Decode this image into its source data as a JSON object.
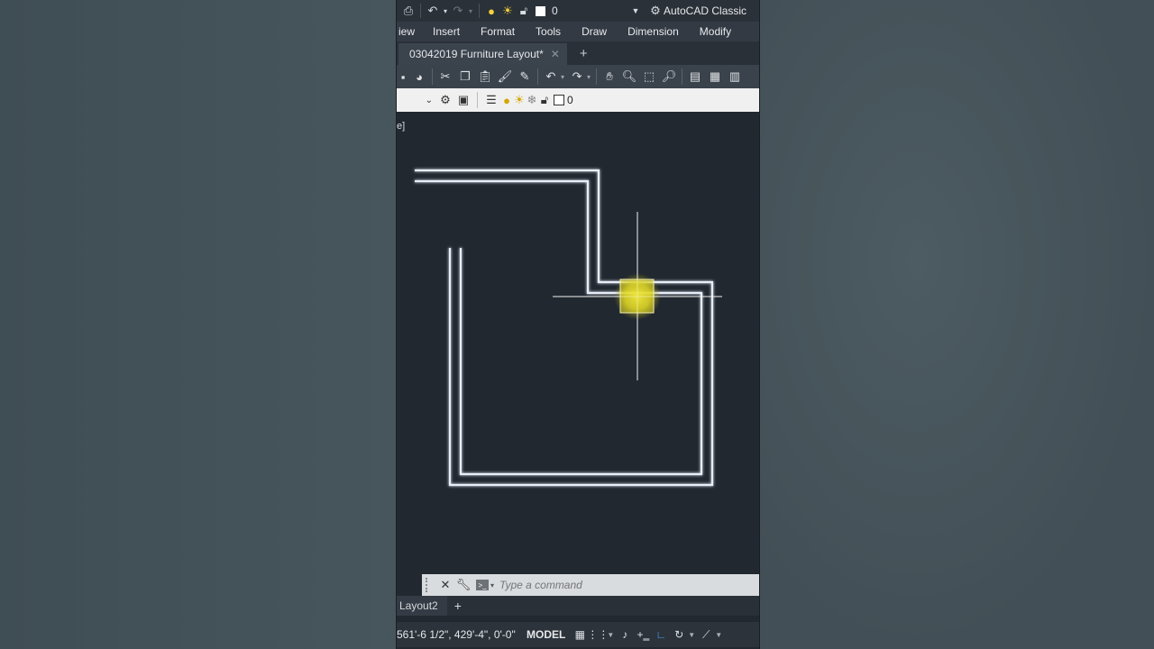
{
  "quick_access": {
    "layer_value": "0",
    "workspace_label": "AutoCAD Classic",
    "icons": [
      "print-icon",
      "undo-icon",
      "redo-icon",
      "bulb-icon",
      "sun-icon",
      "lock-icon",
      "color-swatch-icon",
      "gear-icon"
    ]
  },
  "menu": {
    "items": [
      "View",
      "Insert",
      "Format",
      "Tools",
      "Draw",
      "Dimension",
      "Modify"
    ],
    "visible": [
      "View",
      "Insert",
      "Format",
      "Tools",
      "Draw",
      "Dimension",
      "Modify"
    ],
    "partial_first": "iew"
  },
  "document_tab": {
    "title": "03042019 Furniture Layout*",
    "close_symbol": "✕",
    "new_symbol": "+"
  },
  "layer_bar": {
    "layer_value": "0"
  },
  "viewport": {
    "label": "e]"
  },
  "command_line": {
    "placeholder": "Type a command",
    "prompt_symbol": ">_"
  },
  "layout_tabs": {
    "current": "Layout2",
    "add_symbol": "+"
  },
  "status_bar": {
    "coordinates": "561'-6 1/2\", 429'-4\", 0'-0\"",
    "mode": "MODEL"
  },
  "colors": {
    "canvas": "#212830",
    "wall_line": "#e8eef8",
    "cursor_highlight": "#e6e02a",
    "accent_blue": "#4aa3ff"
  }
}
